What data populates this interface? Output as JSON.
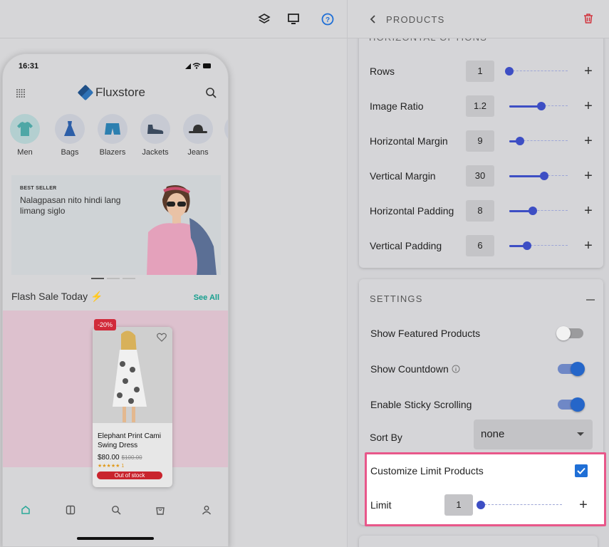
{
  "toolbar": {
    "icons": [
      "layers-icon",
      "desktop-icon",
      "help-icon"
    ]
  },
  "phone": {
    "time": "16:31",
    "logo": "Fluxstore",
    "categories": [
      {
        "label": "Men"
      },
      {
        "label": "Bags"
      },
      {
        "label": "Blazers"
      },
      {
        "label": "Jackets"
      },
      {
        "label": "Jeans"
      }
    ],
    "banner": {
      "tag": "BEST SELLER",
      "text": "Nalagpasan nito hindi lang limang siglo"
    },
    "flash_title": "Flash Sale Today ⚡",
    "see_all": "See All",
    "product": {
      "discount": "-20%",
      "name": "Elephant Print Cami Swing Dress",
      "price": "$80.00",
      "old_price": "$100.00",
      "stars": "★★★★★ 1",
      "stock": "Out of stock"
    }
  },
  "panel": {
    "title": "PRODUCTS",
    "cut_section": "HORIZONTAL OPTIONS",
    "rows": [
      {
        "label": "Rows",
        "value": "1",
        "level": 0.0
      },
      {
        "label": "Image Ratio",
        "value": "1.2",
        "level": 0.55
      },
      {
        "label": "Horizontal Margin",
        "value": "9",
        "level": 0.18
      },
      {
        "label": "Vertical Margin",
        "value": "30",
        "level": 0.6
      },
      {
        "label": "Horizontal Padding",
        "value": "8",
        "level": 0.4
      },
      {
        "label": "Vertical Padding",
        "value": "6",
        "level": 0.3
      }
    ],
    "settings": {
      "title": "SETTINGS",
      "featured": {
        "label": "Show Featured Products",
        "on": false
      },
      "countdown": {
        "label": "Show Countdown",
        "on": true
      },
      "sticky": {
        "label": "Enable Sticky Scrolling",
        "on": true
      },
      "sort": {
        "label": "Sort By",
        "value": "none"
      },
      "limit_toggle": {
        "label": "Customize Limit Products",
        "checked": true
      },
      "limit": {
        "label": "Limit",
        "value": "1",
        "level": 0.0
      }
    }
  },
  "colors": {
    "accent": "#3d4ec4",
    "highlight": "#e8578a",
    "delete": "#d1343d",
    "checkbox": "#1f6fd6"
  }
}
